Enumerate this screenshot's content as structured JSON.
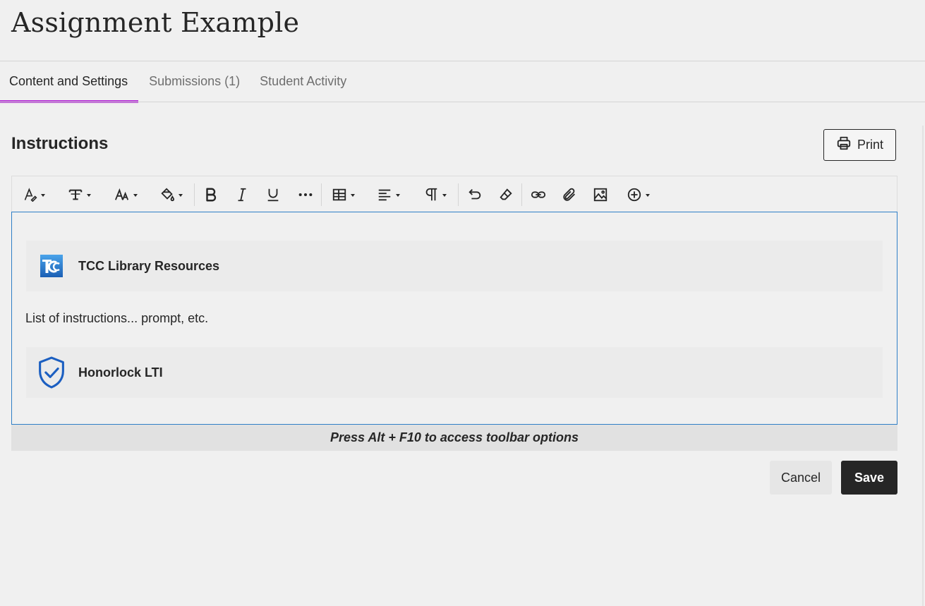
{
  "header": {
    "title": "Assignment Example"
  },
  "tabs": [
    {
      "label": "Content and Settings",
      "active": true
    },
    {
      "label": "Submissions (1)",
      "active": false
    },
    {
      "label": "Student Activity",
      "active": false
    }
  ],
  "instructions": {
    "heading": "Instructions",
    "print_label": "Print"
  },
  "toolbar": {
    "items": [
      "text-style-icon",
      "formatting-icon",
      "font-size-icon",
      "fill-color-icon",
      "bold-icon",
      "italic-icon",
      "underline-icon",
      "more-icon",
      "table-icon",
      "align-icon",
      "paragraph-icon",
      "undo-icon",
      "clear-format-icon",
      "link-icon",
      "attachment-icon",
      "image-icon",
      "insert-content-icon"
    ]
  },
  "editor": {
    "cards": [
      {
        "name": "TCC Library Resources",
        "logo": "tcc-logo"
      },
      {
        "name": "Honorlock LTI",
        "logo": "shield-check-icon"
      }
    ],
    "body_text": "List of instructions... prompt, etc.",
    "hint": "Press Alt + F10 to access toolbar options"
  },
  "footer": {
    "cancel_label": "Cancel",
    "save_label": "Save"
  },
  "colors": {
    "accent_tab": "#b73ad6",
    "editor_border": "#2f7fc7",
    "save_bg": "#262626",
    "honorlock_blue": "#1c5fc1"
  }
}
